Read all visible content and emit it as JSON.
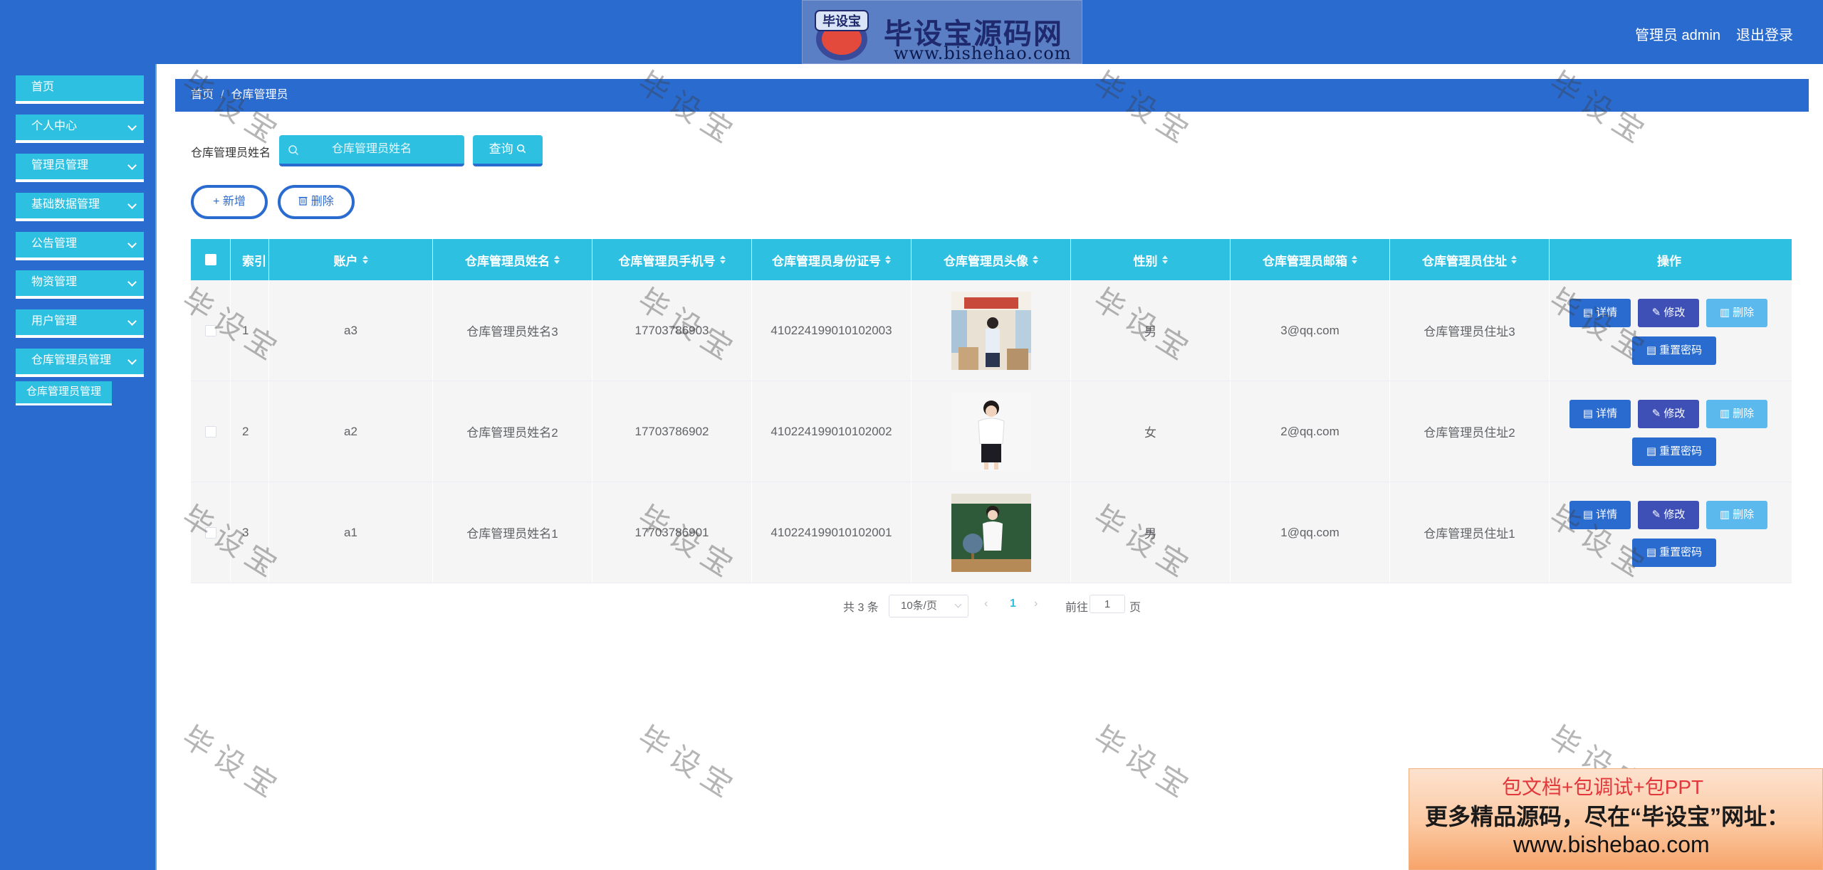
{
  "header": {
    "logo_title": "毕设宝源码网",
    "logo_url": "www.bishehao.com",
    "logo_badge_text": "毕设宝",
    "user_label": "管理员 admin",
    "logout_label": "退出登录",
    "bg_color": "#2a6bcf"
  },
  "sidebar": {
    "items": [
      {
        "label": "首页",
        "icon": "",
        "expandable": false
      },
      {
        "label": "个人中心",
        "icon": "chevron-down-icon",
        "expandable": true
      },
      {
        "label": "管理员管理",
        "icon": "chevron-down-icon",
        "expandable": true
      },
      {
        "label": "基础数据管理",
        "icon": "chevron-down-icon",
        "expandable": true
      },
      {
        "label": "公告管理",
        "icon": "chevron-down-icon",
        "expandable": true
      },
      {
        "label": "物资管理",
        "icon": "chevron-down-icon",
        "expandable": true
      },
      {
        "label": "用户管理",
        "icon": "chevron-down-icon",
        "expandable": true
      },
      {
        "label": "仓库管理员管理",
        "icon": "chevron-down-icon",
        "expandable": true
      }
    ],
    "submenu_label": "仓库管理员管理",
    "accent_color": "#2ec0e0"
  },
  "breadcrumb": {
    "home": "首页",
    "separator": "/",
    "current": "仓库管理员"
  },
  "search": {
    "label": "仓库管理员姓名",
    "placeholder": "仓库管理员姓名",
    "value": "",
    "query_label": "查询"
  },
  "actions": {
    "add_label": "新增",
    "delete_label": "删除"
  },
  "table": {
    "headers": [
      "索引",
      "账户",
      "仓库管理员姓名",
      "仓库管理员手机号",
      "仓库管理员身份证号",
      "仓库管理员头像",
      "性别",
      "仓库管理员邮箱",
      "仓库管理员住址",
      "操作"
    ],
    "rows": [
      {
        "index": "1",
        "account": "a3",
        "name": "仓库管理员姓名3",
        "phone": "17703786903",
        "idcard": "410224199010102003",
        "avatar": "teacher-classroom-photo",
        "gender": "男",
        "email": "3@qq.com",
        "address": "仓库管理员住址3"
      },
      {
        "index": "2",
        "account": "a2",
        "name": "仓库管理员姓名2",
        "phone": "17703786902",
        "idcard": "410224199010102002",
        "avatar": "woman-portrait-photo",
        "gender": "女",
        "email": "2@qq.com",
        "address": "仓库管理员住址2"
      },
      {
        "index": "3",
        "account": "a1",
        "name": "仓库管理员姓名1",
        "phone": "17703786901",
        "idcard": "410224199010102001",
        "avatar": "teacher-globe-photo",
        "gender": "男",
        "email": "1@qq.com",
        "address": "仓库管理员住址1"
      }
    ],
    "op_labels": {
      "detail": "详情",
      "edit": "修改",
      "delete": "删除",
      "reset": "重置密码"
    }
  },
  "pagination": {
    "total_text": "共 3 条",
    "page_size": "10条/页",
    "current_page": "1",
    "goto_label": "前往",
    "goto_value": "1",
    "page_suffix": "页"
  },
  "watermark": {
    "text": "毕设宝"
  },
  "ad": {
    "line1": "包文档+包调试+包PPT",
    "line2": "更多精品源码，尽在“毕设宝”网址：",
    "line3": "www.bishebao.com"
  }
}
